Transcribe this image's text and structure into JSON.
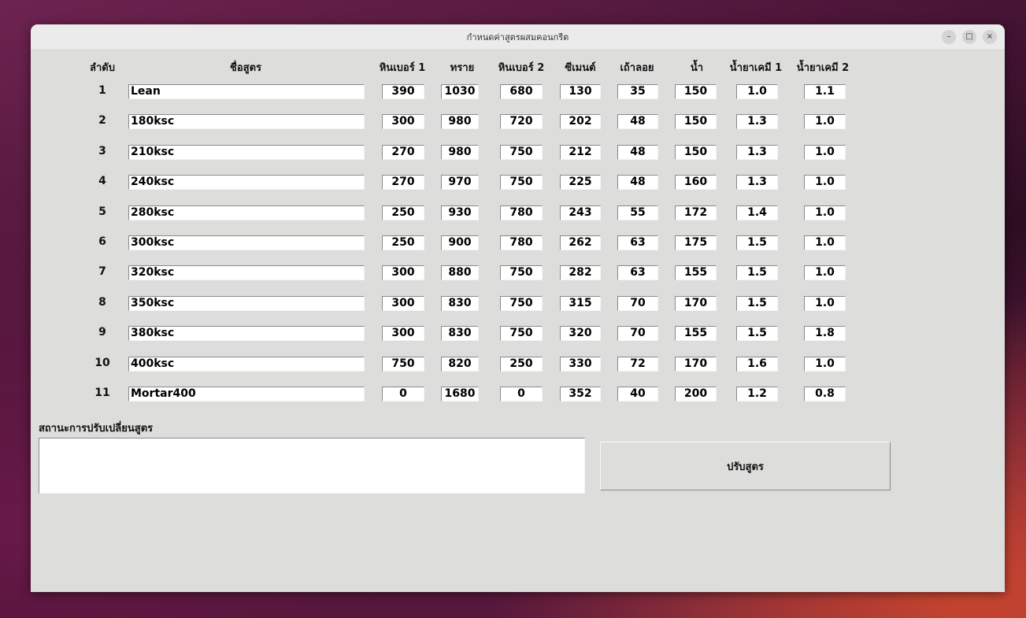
{
  "window": {
    "title": "กำหนดค่าสูตรผสมคอนกรีต",
    "controls": {
      "minimize": "–",
      "maximize": "□",
      "close": "×"
    }
  },
  "headers": [
    "ลำดับ",
    "ชื่อสูตร",
    "หินเบอร์ 1",
    "ทราย",
    "หินเบอร์ 2",
    "ซีเมนต์",
    "เถ้าลอย",
    "น้ำ",
    "น้ำยาเคมี 1",
    "น้ำยาเคมี 2"
  ],
  "rows": [
    {
      "no": "1",
      "name": "Lean",
      "values": [
        "390",
        "1030",
        "680",
        "130",
        "35",
        "150",
        "1.0",
        "1.1"
      ]
    },
    {
      "no": "2",
      "name": "180ksc",
      "values": [
        "300",
        "980",
        "720",
        "202",
        "48",
        "150",
        "1.3",
        "1.0"
      ]
    },
    {
      "no": "3",
      "name": "210ksc",
      "values": [
        "270",
        "980",
        "750",
        "212",
        "48",
        "150",
        "1.3",
        "1.0"
      ]
    },
    {
      "no": "4",
      "name": "240ksc",
      "values": [
        "270",
        "970",
        "750",
        "225",
        "48",
        "160",
        "1.3",
        "1.0"
      ]
    },
    {
      "no": "5",
      "name": "280ksc",
      "values": [
        "250",
        "930",
        "780",
        "243",
        "55",
        "172",
        "1.4",
        "1.0"
      ]
    },
    {
      "no": "6",
      "name": "300ksc",
      "values": [
        "250",
        "900",
        "780",
        "262",
        "63",
        "175",
        "1.5",
        "1.0"
      ]
    },
    {
      "no": "7",
      "name": "320ksc",
      "values": [
        "300",
        "880",
        "750",
        "282",
        "63",
        "155",
        "1.5",
        "1.0"
      ]
    },
    {
      "no": "8",
      "name": "350ksc",
      "values": [
        "300",
        "830",
        "750",
        "315",
        "70",
        "170",
        "1.5",
        "1.0"
      ]
    },
    {
      "no": "9",
      "name": "380ksc",
      "values": [
        "300",
        "830",
        "750",
        "320",
        "70",
        "155",
        "1.5",
        "1.8"
      ]
    },
    {
      "no": "10",
      "name": "400ksc",
      "values": [
        "750",
        "820",
        "250",
        "330",
        "72",
        "170",
        "1.6",
        "1.0"
      ]
    },
    {
      "no": "11",
      "name": "Mortar400",
      "values": [
        "0",
        "1680",
        "0",
        "352",
        "40",
        "200",
        "1.2",
        "0.8"
      ]
    }
  ],
  "status": {
    "label": "สถานะการปรับเปลี่ยนสูตร",
    "text": ""
  },
  "action": {
    "label": "ปรับสูตร"
  }
}
